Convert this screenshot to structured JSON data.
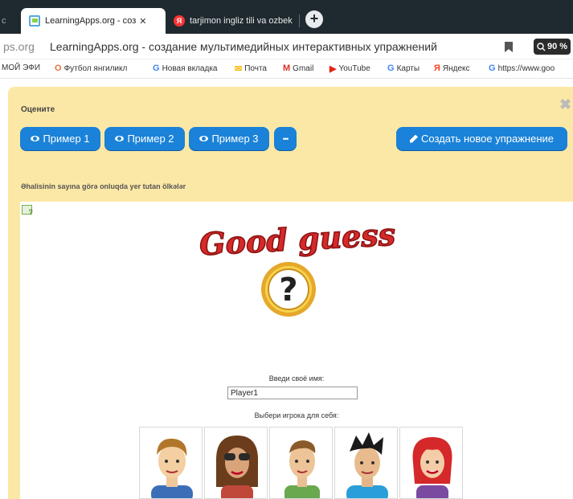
{
  "browser": {
    "tab_partial_text": "с",
    "active_tab": {
      "title": "LearningApps.org - соз",
      "close": "✕"
    },
    "inactive_tab": {
      "title": "tarjimon ingliz tili va ozbek"
    },
    "new_tab": "+"
  },
  "address_bar": {
    "domain": "ps.org",
    "title": "LearningApps.org - создание мультимедийных интерактивных упражнений",
    "zoom": "90 %"
  },
  "bookmarks": [
    {
      "icon_text": "",
      "label": "МОЙ ЭФИ"
    },
    {
      "icon_text": "O",
      "label": "Футбол янгиликл",
      "color": "#e8743b"
    },
    {
      "icon_text": "G",
      "label": "Новая вкладка",
      "color": "#4285f4"
    },
    {
      "icon_text": "✉",
      "label": "Почта",
      "color": "#f5b800"
    },
    {
      "icon_text": "M",
      "label": "Gmail",
      "color": "#d93025"
    },
    {
      "icon_text": "▶",
      "label": "YouTube",
      "color": "#e62117"
    },
    {
      "icon_text": "G",
      "label": "Карты",
      "color": "#4285f4"
    },
    {
      "icon_text": "Я",
      "label": "Яндекс",
      "color": "#fc3f1d"
    },
    {
      "icon_text": "G",
      "label": "https://www.goo",
      "color": "#4285f4"
    }
  ],
  "panel": {
    "title": "Оцените",
    "close": "✖",
    "buttons": {
      "example1": "Пример 1",
      "example2": "Пример 2",
      "example3": "Пример 3",
      "more": "•••",
      "create": "Создать новое упражнение"
    },
    "exercise_title": "Əhalisinin sayına görə onluqda yer tutan ölkələr"
  },
  "game": {
    "banner": "Good guess",
    "question_mark": "?",
    "name_label": "Введи своё имя:",
    "name_value": "Player1",
    "choose_label": "Выбери игрока для себя:"
  },
  "colors": {
    "panel_bg": "#fce8a6",
    "button_blue": "#1a82d8",
    "banner_red": "#d42a2a"
  }
}
